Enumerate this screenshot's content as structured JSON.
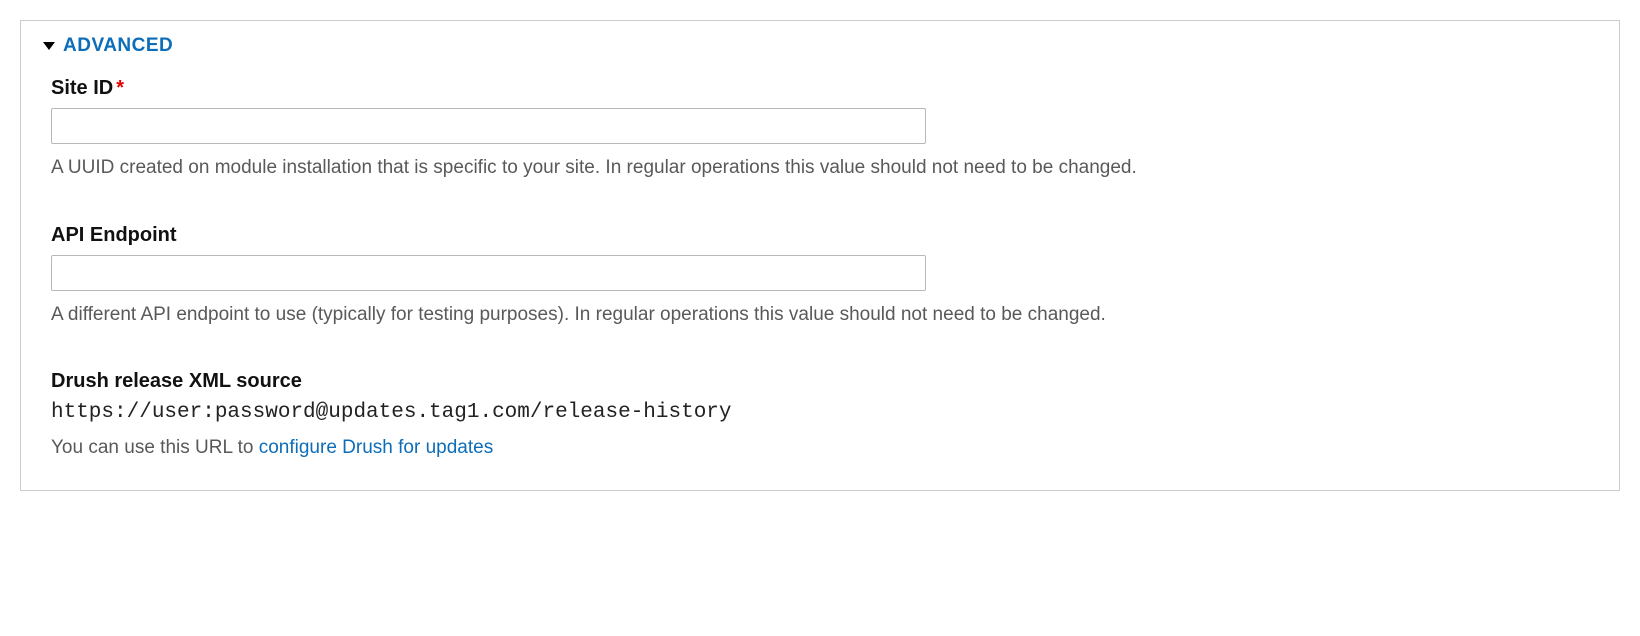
{
  "fieldset": {
    "legend": "ADVANCED"
  },
  "site_id": {
    "label": "Site ID",
    "required_mark": "*",
    "value": "",
    "description": "A UUID created on module installation that is specific to your site. In regular operations this value should not need to be changed."
  },
  "api_endpoint": {
    "label": "API Endpoint",
    "value": "",
    "description": "A different API endpoint to use (typically for testing purposes). In regular operations this value should not need to be changed."
  },
  "drush": {
    "label": "Drush release XML source",
    "value": "https://user:password@updates.tag1.com/release-history",
    "description_prefix": "You can use this URL to ",
    "link_text": "configure Drush for updates"
  }
}
